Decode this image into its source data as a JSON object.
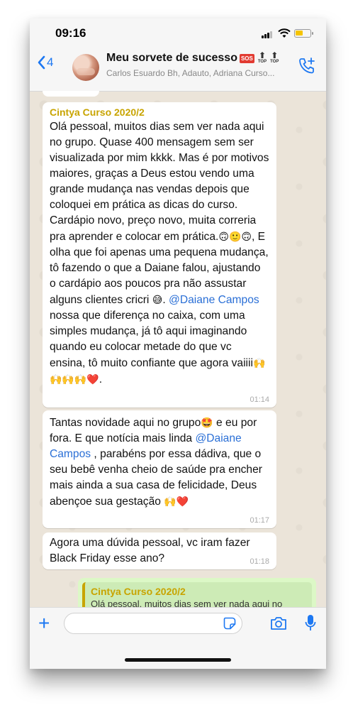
{
  "status_bar": {
    "time": "09:16"
  },
  "header": {
    "back_count": "4",
    "title": "Meu sorvete de sucesso",
    "sos": "SOS",
    "top_badge": "TOP",
    "subtitle": "Carlos Esuardo Bh, Adauto, Adriana Curso..."
  },
  "messages": [
    {
      "sender": "Cintya Curso 2020/2",
      "text_a": "Olá pessoal, muitos dias sem ver nada aqui no grupo. Quase 400 mensagem sem ser visualizada por mim kkkk. Mas é por motivos maiores, graças a Deus estou vendo uma grande mudança nas vendas depois que coloquei em prática as dicas do curso. Cardápio novo, preço novo, muita correria pra aprender e colocar em prática.",
      "emoji_a": "🙃🙂🙃",
      "text_b": ", E olha que foi apenas uma pequena mudança, tô fazendo o que a Daiane falou, ajustando o cardápio aos poucos pra não assustar alguns clientes cricri",
      "emoji_b": "😅",
      "text_c": ". ",
      "mention": "@Daiane Campos",
      "text_d": "  nossa que diferença no caixa, com uma simples mudança, já tô aqui imaginando quando eu colocar metade do que vc ensina, tô muito confiante que agora vaiiii",
      "emoji_d": "🙌🙌🙌🙌❤️",
      "text_e": ".",
      "time": "01:14"
    },
    {
      "text_a": "Tantas novidade aqui no grupo",
      "emoji_a": "🤩",
      "text_b": " e eu por fora. E que notícia mais linda ",
      "mention": "@Daiane Campos",
      "text_c": " , parabéns por essa dádiva, que o seu bebê venha cheio de saúde pra encher mais ainda a sua casa de felicidade, Deus abençoe sua gestação ",
      "emoji_c": "🙌❤️",
      "time": "01:17"
    },
    {
      "text": "Agora uma dúvida pessoal, vc iram fazer Black Friday esse ano?",
      "time": "01:18"
    }
  ],
  "reply": {
    "sender": "Cintya Curso 2020/2",
    "text": "Olá pessoal, muitos dias sem ver nada aqui no"
  },
  "input": {
    "placeholder": ""
  },
  "colors": {
    "accent": "#1d78f2",
    "sender": "#c8a400",
    "mention": "#2a6fd6",
    "outgoing": "#dcf8c6"
  }
}
